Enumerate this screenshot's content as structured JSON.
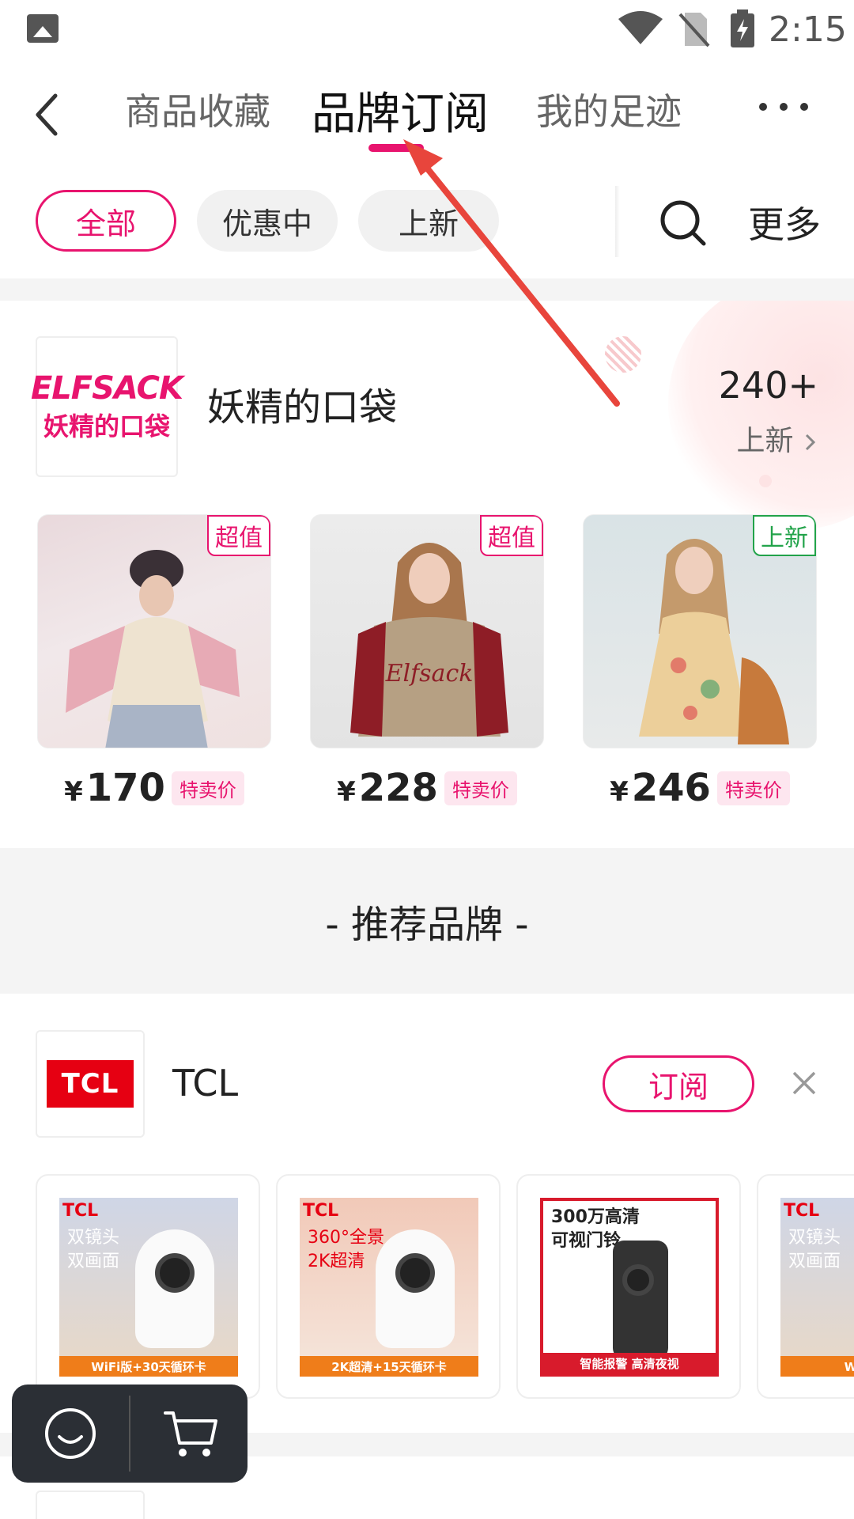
{
  "status_bar": {
    "time": "2:15"
  },
  "top_nav": {
    "tabs": [
      {
        "label": "商品收藏",
        "active": false
      },
      {
        "label": "品牌订阅",
        "active": true
      },
      {
        "label": "我的足迹",
        "active": false
      }
    ]
  },
  "filters": {
    "chips": [
      "全部",
      "优惠中",
      "上新"
    ],
    "more_label": "更多"
  },
  "brand": {
    "logo_text_line1": "ELFSACK",
    "logo_text_line2": "妖精的口袋",
    "name": "妖精的口袋",
    "new_count": "240+",
    "new_label": "上新",
    "products": [
      {
        "badge": "超值",
        "badge_color": "#e8146e",
        "currency": "¥",
        "price": "170",
        "tag": "特卖价"
      },
      {
        "badge": "超值",
        "badge_color": "#e8146e",
        "currency": "¥",
        "price": "228",
        "tag": "特卖价"
      },
      {
        "badge": "上新",
        "badge_color": "#22a34a",
        "currency": "¥",
        "price": "246",
        "tag": "特卖价"
      }
    ]
  },
  "recommend": {
    "header": "-  推荐品牌  -",
    "brand_name": "TCL",
    "logo_text": "TCL",
    "subscribe_label": "订阅",
    "items": [
      {
        "logo": "TCL",
        "headline_1": "双镜头",
        "headline_2": "双画面",
        "banner": "WiFi版+30天循环卡"
      },
      {
        "logo": "TCL",
        "headline_1": "360°全景",
        "headline_2": "2K超清",
        "banner": "2K超清+15天循环卡"
      },
      {
        "logo": "",
        "headline_1": "300万高清",
        "headline_2": "可视门铃",
        "banner": "智能报警 高清夜视"
      },
      {
        "logo": "TCL",
        "headline_1": "双镜头",
        "headline_2": "双画面",
        "banner": "WiFi版+"
      }
    ]
  },
  "colors": {
    "accent": "#e8146e",
    "tcl_red": "#e60012",
    "annotation_arrow": "#e8453c"
  },
  "icons": [
    "image-icon",
    "wifi-icon",
    "no-sim-icon",
    "battery-icon",
    "back-icon",
    "more-icon",
    "search-icon",
    "chevron-right-icon",
    "close-icon",
    "smile-icon",
    "cart-icon"
  ]
}
